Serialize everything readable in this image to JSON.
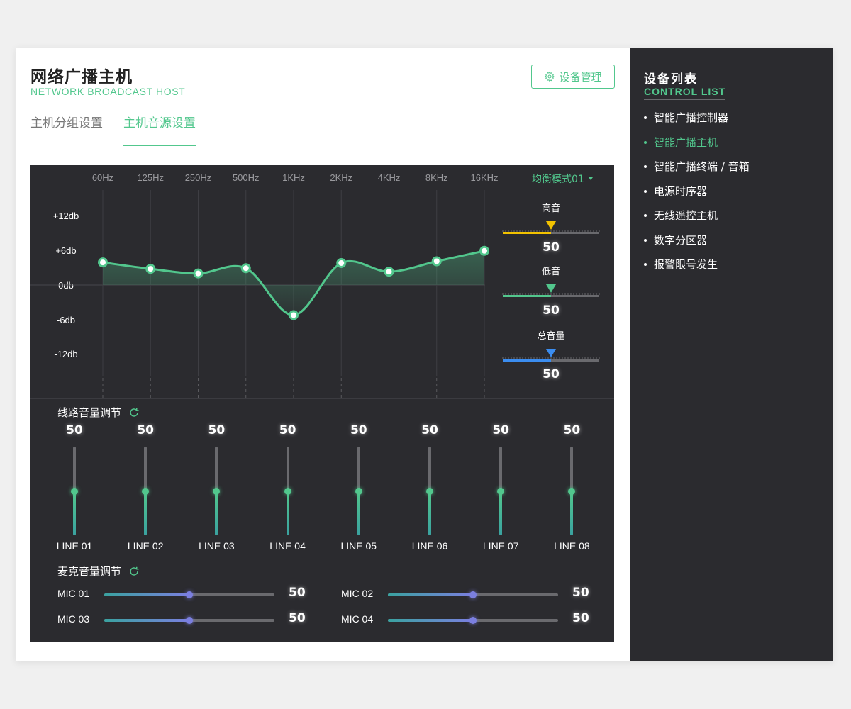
{
  "header": {
    "title_cn": "网络广播主机",
    "title_en": "NETWORK BROADCAST HOST",
    "device_button": "设备管理"
  },
  "tabs": [
    {
      "label": "主机分组设置",
      "active": false
    },
    {
      "label": "主机音源设置",
      "active": true
    }
  ],
  "equalizer": {
    "mode": "均衡模式01",
    "frequencies": [
      "60Hz",
      "125Hz",
      "250Hz",
      "500Hz",
      "1KHz",
      "2KHz",
      "4KHz",
      "8KHz",
      "16KHz"
    ],
    "db_labels": [
      "+12db",
      "+6db",
      "0db",
      "-6db",
      "-12db"
    ],
    "db_values": [
      3.9,
      2.8,
      2.0,
      2.9,
      -5.2,
      3.8,
      2.3,
      4.1,
      5.9
    ]
  },
  "tone_controls": [
    {
      "label": "高音",
      "value": "50",
      "level": 0.5,
      "color": "#f2c200"
    },
    {
      "label": "低音",
      "value": "50",
      "level": 0.5,
      "color": "#52c78d"
    },
    {
      "label": "总音量",
      "value": "50",
      "level": 0.5,
      "color": "#3b8df0"
    }
  ],
  "line_volume": {
    "title": "线路音量调节",
    "channels": [
      {
        "label": "LINE 01",
        "value": "50",
        "level": 0.5
      },
      {
        "label": "LINE 02",
        "value": "50",
        "level": 0.5
      },
      {
        "label": "LINE 03",
        "value": "50",
        "level": 0.5
      },
      {
        "label": "LINE 04",
        "value": "50",
        "level": 0.5
      },
      {
        "label": "LINE 05",
        "value": "50",
        "level": 0.5
      },
      {
        "label": "LINE 06",
        "value": "50",
        "level": 0.5
      },
      {
        "label": "LINE 07",
        "value": "50",
        "level": 0.5
      },
      {
        "label": "LINE 08",
        "value": "50",
        "level": 0.5
      }
    ]
  },
  "mic_volume": {
    "title": "麦克音量调节",
    "channels": [
      {
        "label": "MIC 01",
        "value": "50",
        "level": 0.5
      },
      {
        "label": "MIC 02",
        "value": "50",
        "level": 0.5
      },
      {
        "label": "MIC 03",
        "value": "50",
        "level": 0.5
      },
      {
        "label": "MIC 04",
        "value": "50",
        "level": 0.5
      }
    ]
  },
  "sidebar": {
    "title": "设备列表",
    "subtitle": "CONTROL LIST",
    "items": [
      {
        "label": "智能广播控制器",
        "active": false
      },
      {
        "label": "智能广播主机",
        "active": true
      },
      {
        "label": "智能广播终端 / 音箱",
        "active": false
      },
      {
        "label": "电源时序器",
        "active": false
      },
      {
        "label": "无线遥控主机",
        "active": false
      },
      {
        "label": "数字分区器",
        "active": false
      },
      {
        "label": "报警限号发生",
        "active": false
      }
    ]
  },
  "colors": {
    "accent": "#52c78d",
    "panel": "#2b2b2f",
    "treble": "#f2c200",
    "bass": "#52c78d",
    "master": "#3b8df0",
    "mic": "#7b7fe0"
  }
}
